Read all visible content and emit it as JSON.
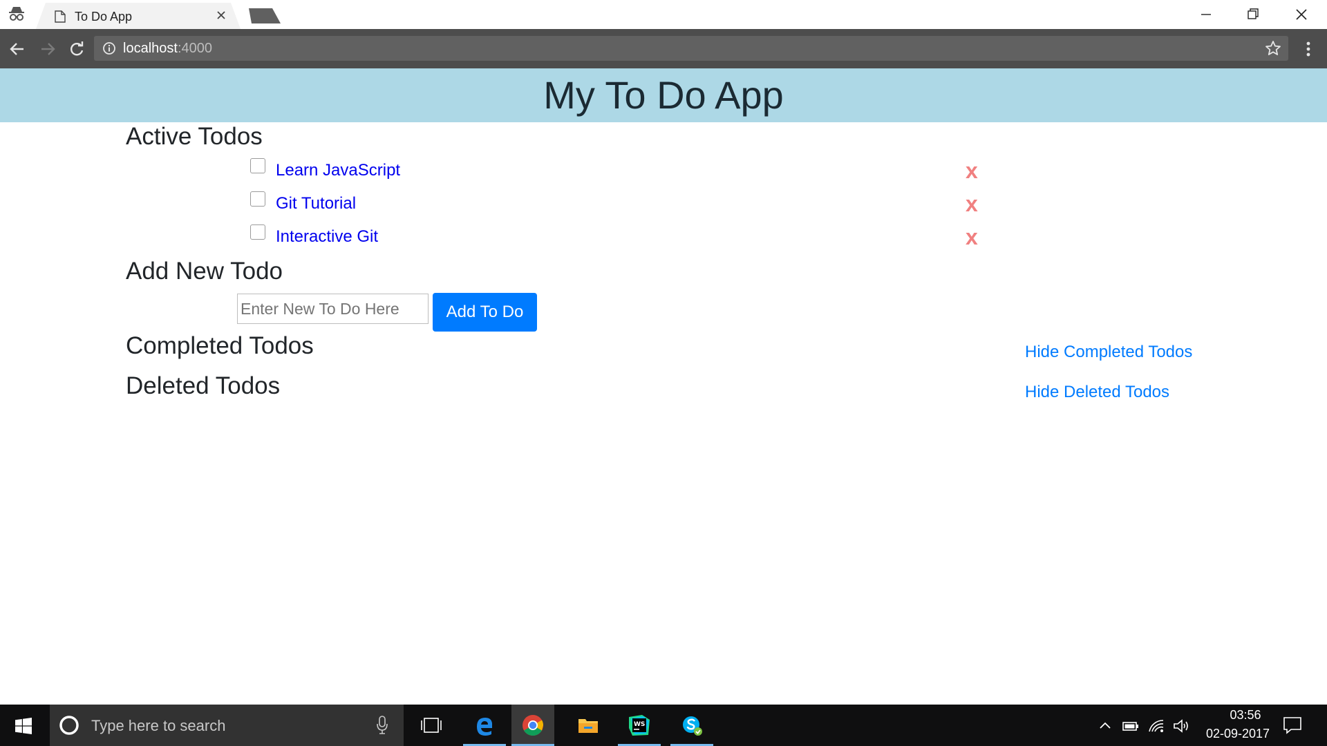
{
  "browser": {
    "tab_title": "To Do App",
    "url_host": "localhost",
    "url_port": ":4000"
  },
  "app": {
    "title": "My To Do App",
    "active_heading": "Active Todos",
    "active_todos": [
      {
        "label": "Learn JavaScript",
        "checked": false,
        "delete_label": "x"
      },
      {
        "label": "Git Tutorial",
        "checked": false,
        "delete_label": "x"
      },
      {
        "label": "Interactive Git",
        "checked": false,
        "delete_label": "x"
      }
    ],
    "add_heading": "Add New Todo",
    "new_todo_placeholder": "Enter New To Do Here",
    "add_button_label": "Add To Do",
    "completed_heading": "Completed Todos",
    "hide_completed_label": "Hide Completed Todos",
    "deleted_heading": "Deleted Todos",
    "hide_deleted_label": "Hide Deleted Todos"
  },
  "colors": {
    "header_bg": "#add8e6",
    "link_blue": "#0000ee",
    "button_blue": "#007bff",
    "delete_red": "#f08080"
  },
  "taskbar": {
    "search_placeholder": "Type here to search",
    "apps": [
      "edge-icon",
      "chrome-icon",
      "file-explorer-icon",
      "webstorm-icon",
      "skype-icon"
    ],
    "time": "03:56",
    "date": "02-09-2017"
  }
}
